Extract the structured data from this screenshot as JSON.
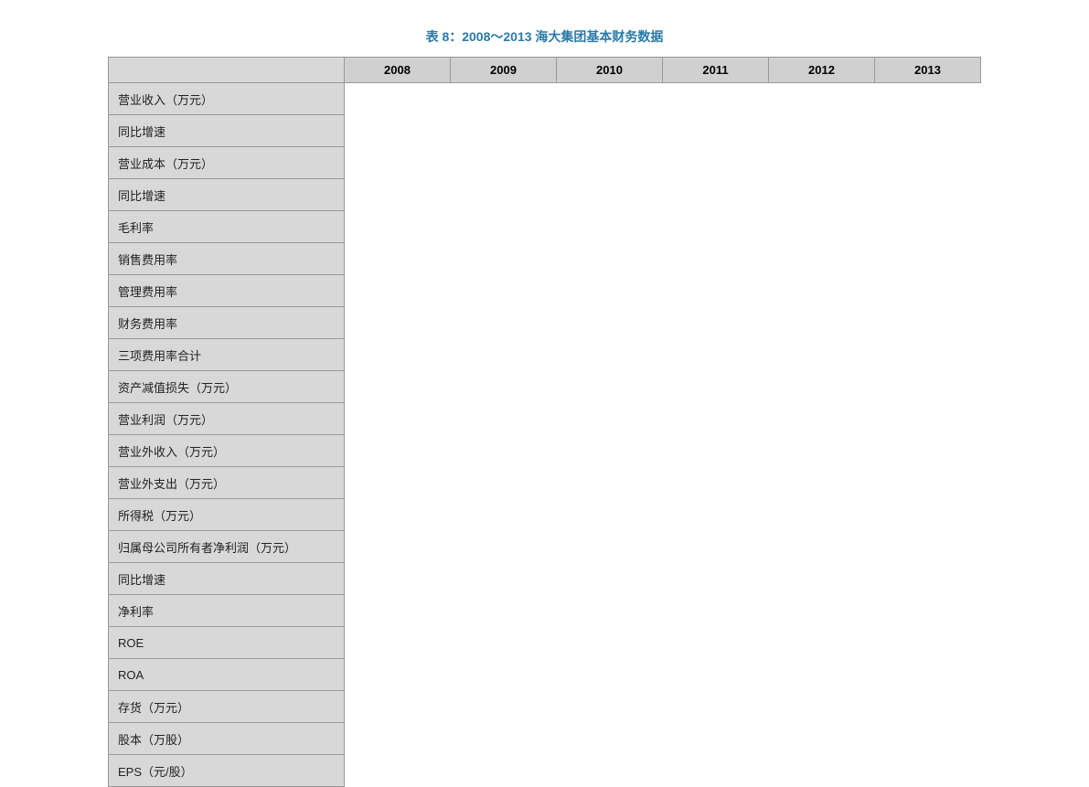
{
  "title": "表 8：2008～2013 海大集团基本财务数据",
  "years": [
    "2008",
    "2009",
    "2010",
    "2011",
    "2012",
    "2013"
  ],
  "rows": [
    {
      "label": "营业收入（万元）"
    },
    {
      "label": "同比增速"
    },
    {
      "label": "营业成本（万元）"
    },
    {
      "label": "同比增速"
    },
    {
      "label": "毛利率"
    },
    {
      "label": "销售费用率"
    },
    {
      "label": "管理费用率"
    },
    {
      "label": "财务费用率"
    },
    {
      "label": "三项费用率合计"
    },
    {
      "label": "资产减值损失（万元）"
    },
    {
      "label": "营业利润（万元）"
    },
    {
      "label": "营业外收入（万元）"
    },
    {
      "label": "营业外支出（万元）"
    },
    {
      "label": "所得税（万元）"
    },
    {
      "label": "归属母公司所有者净利润（万元）"
    },
    {
      "label": "同比增速"
    },
    {
      "label": "净利率"
    },
    {
      "label": "ROE"
    },
    {
      "label": "ROA"
    },
    {
      "label": "存货（万元）"
    },
    {
      "label": "股本（万股）"
    },
    {
      "label": "EPS（元/股）"
    }
  ]
}
